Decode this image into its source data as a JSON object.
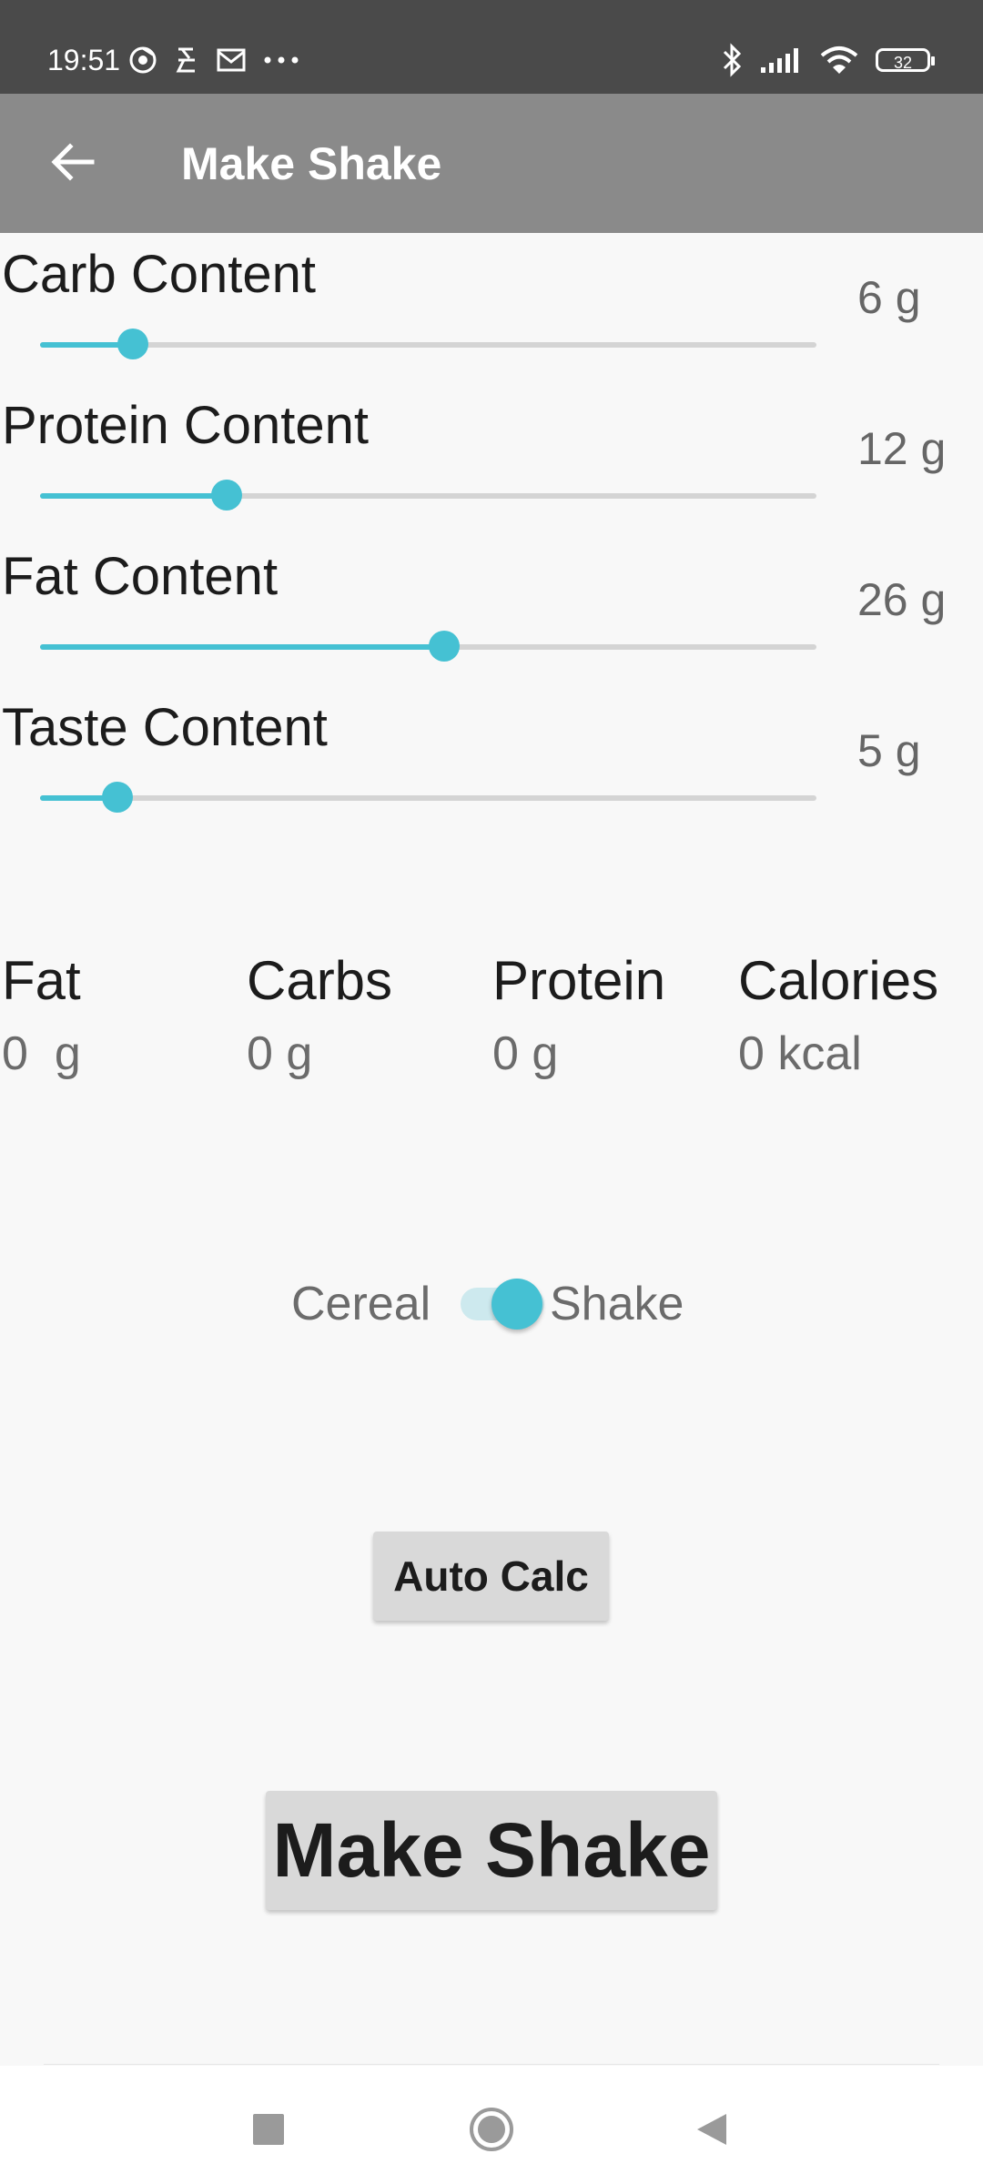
{
  "status_bar": {
    "time": "19:51",
    "left_icons": [
      "chrome-icon",
      "signal-app-icon",
      "mail-icon",
      "more-dots-icon"
    ],
    "right_icons": [
      "bluetooth-icon",
      "cellular-signal-icon",
      "wifi-icon",
      "battery-icon"
    ],
    "battery_level": "32"
  },
  "toolbar": {
    "title": "Make Shake",
    "back_icon": "arrow-left-icon"
  },
  "sliders": [
    {
      "label": "Carb Content",
      "value": "6 g",
      "fraction": 0.12
    },
    {
      "label": "Protein Content",
      "value": "12 g",
      "fraction": 0.24
    },
    {
      "label": "Fat Content",
      "value": "26 g",
      "fraction": 0.52
    },
    {
      "label": "Taste Content",
      "value": "5 g",
      "fraction": 0.1
    }
  ],
  "nutrition": {
    "fat": {
      "label": "Fat",
      "value": "0  g"
    },
    "carbs": {
      "label": "Carbs",
      "value": "0 g"
    },
    "protein": {
      "label": "Protein",
      "value": "0 g"
    },
    "calories": {
      "label": "Calories",
      "value": "0 kcal"
    }
  },
  "toggle": {
    "left_label": "Cereal",
    "right_label": "Shake",
    "checked": true
  },
  "buttons": {
    "auto_calc": "Auto Calc",
    "make_shake": "Make Shake"
  },
  "colors": {
    "accent": "#45c1d3",
    "toolbar": "#8a8a8a",
    "status_bar": "#4a4a4a",
    "background": "#f8f8f8"
  }
}
